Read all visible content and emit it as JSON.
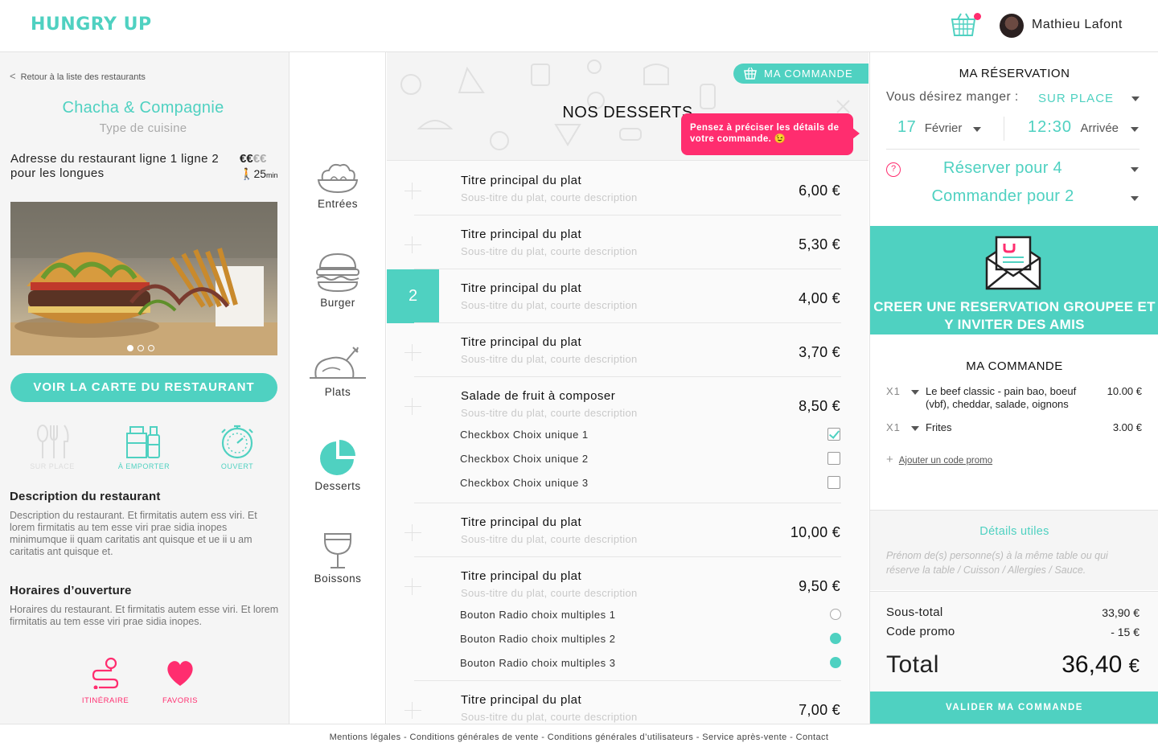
{
  "header": {
    "logo": "HUNGRY UP",
    "user_name": "Mathieu Lafont"
  },
  "restaurant": {
    "back_label": "Retour à la liste des restaurants",
    "name": "Chacha & Compagnie",
    "cuisine": "Type de cuisine",
    "address": "Adresse du restaurant ligne 1 ligne 2 pour les longues",
    "price_on": "€€",
    "price_off": "€€",
    "delay": "25",
    "delay_unit": "min",
    "photo_slide_count": 3,
    "photo_active_slide": 1,
    "cta": "VOIR LA CARTE DU RESTAURANT",
    "services": [
      {
        "label": "SUR PLACE",
        "active": false,
        "icon": "cutlery-icon"
      },
      {
        "label": "À EMPORTER",
        "active": true,
        "icon": "takeaway-icon"
      },
      {
        "label": "OUVERT",
        "active": true,
        "icon": "stopwatch-icon"
      }
    ],
    "description_title": "Description du restaurant",
    "description": "Description du restaurant. Et firmitatis autem ess viri. Et lorem firmitatis au tem esse viri prae sidia inopes minimumque ii quam caritatis ant quisque et ue ii u am caritatis ant quisque et.",
    "hours_title": "Horaires d’ouverture",
    "hours": "Horaires du restaurant. Et firmitatis autem esse viri. Et lorem firmitatis au tem esse viri prae sidia inopes.",
    "actions": [
      {
        "label": "ITINÉRAIRE",
        "icon": "route-icon"
      },
      {
        "label": "FAVORIS",
        "icon": "heart-icon"
      }
    ]
  },
  "categories": [
    {
      "label": "Entrées",
      "icon": "salad-bowl-icon",
      "active": false
    },
    {
      "label": "Burger",
      "icon": "burger-icon",
      "active": false
    },
    {
      "label": "Plats",
      "icon": "roast-chicken-icon",
      "active": false
    },
    {
      "label": "Desserts",
      "icon": "pie-icon",
      "active": true
    },
    {
      "label": "Boissons",
      "icon": "wine-glass-icon",
      "active": false
    }
  ],
  "menu": {
    "title": "NOS DESSERTS",
    "order_tab": "MA COMMANDE",
    "tooltip": "Pensez à préciser les détails de votre commande. 😉",
    "items": [
      {
        "title": "Titre principal du plat",
        "subtitle": "Sous-titre du plat, courte description",
        "price": "6,00 €"
      },
      {
        "title": "Titre principal du plat",
        "subtitle": "Sous-titre du plat, courte description",
        "price": "5,30 €"
      },
      {
        "title": "Titre principal du plat",
        "subtitle": "Sous-titre du plat, courte description",
        "price": "4,00 €",
        "qty": "2"
      },
      {
        "title": "Titre principal du plat",
        "subtitle": "Sous-titre du plat, courte description",
        "price": "3,70 €"
      },
      {
        "title": "Salade de fruit à composer",
        "subtitle": "Sous-titre du plat, courte description",
        "price": "8,50 €",
        "options": [
          {
            "label": "Checkbox Choix unique 1",
            "checked": true
          },
          {
            "label": "Checkbox Choix unique 2",
            "checked": false
          },
          {
            "label": "Checkbox Choix unique 3",
            "checked": false
          }
        ]
      },
      {
        "title": "Titre principal du plat",
        "subtitle": "Sous-titre du plat, courte description",
        "price": "10,00 €"
      },
      {
        "title": "Titre principal du plat",
        "subtitle": "Sous-titre du plat, courte description",
        "price": "9,50 €",
        "options": [
          {
            "label": "Bouton Radio choix multiples 1",
            "checked": false
          },
          {
            "label": "Bouton Radio choix multiples 2",
            "checked": true
          },
          {
            "label": "Bouton Radio choix multiples 3",
            "checked": true
          }
        ]
      },
      {
        "title": "Titre principal du plat",
        "subtitle": "Sous-titre du plat, courte description",
        "price": "7,00 €"
      }
    ]
  },
  "reservation": {
    "title": "MA RÉSERVATION",
    "wish_label": "Vous désirez manger :",
    "wish_value": "SUR PLACE",
    "date_day": "17",
    "date_month": "Février",
    "time_value": "12:30",
    "time_label": "Arrivée",
    "help": "?",
    "reserve_for": "Réserver pour 4",
    "order_for": "Commander pour 2",
    "group_cta": "CREER UNE RESERVATION GROUPEE ET Y INVITER DES AMIS"
  },
  "order": {
    "title": "MA COMMANDE",
    "lines": [
      {
        "qty": "X1",
        "name": "Le beef classic - pain bao, boeuf (vbf), cheddar, salade, oignons",
        "price": "10.00 €"
      },
      {
        "qty": "X1",
        "name": "Frites",
        "price": "3.00 €"
      }
    ],
    "promo_link": "Ajouter un code promo",
    "details_title": "Détails utiles",
    "details_placeholder": "Prénom de(s) personne(s) à la même table ou qui réserve la table / Cuisson / Allergies / Sauce.",
    "subtotal_label": "Sous-total",
    "subtotal": "33,90 €",
    "promo_label": "Code promo",
    "promo_value": "- 15 €",
    "total_label": "Total",
    "total": "36,40",
    "total_currency": "€",
    "validate": "VALIDER MA COMMANDE"
  },
  "footer": {
    "links": [
      "Mentions légales",
      "Conditions générales de vente",
      "Conditions générales d’utilisateurs",
      "Service après-vente",
      "Contact"
    ]
  },
  "colors": {
    "accent": "#4fd1c1",
    "alert": "#ff2d6f"
  }
}
